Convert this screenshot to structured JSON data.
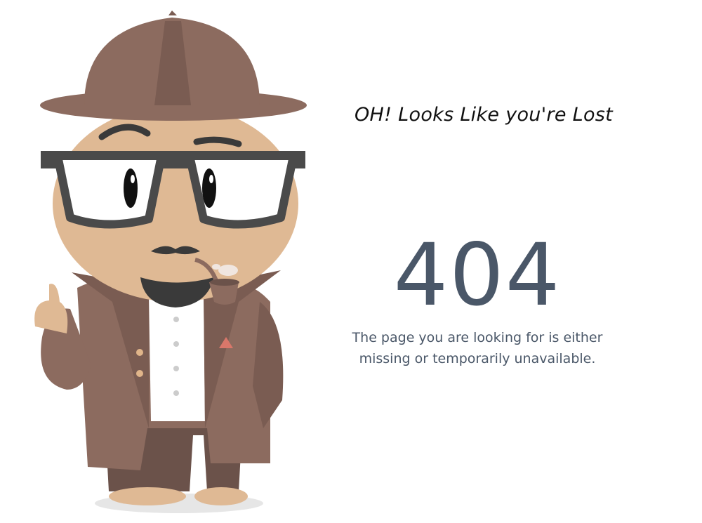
{
  "heading": "OH! Looks Like you're Lost",
  "error_code": "404",
  "message": {
    "line1": "The page you are looking for is either",
    "line2": "missing or temporarily unavailable."
  },
  "illustration": {
    "name": "detective-mascot",
    "colors": {
      "hat": "#8c6b5f",
      "skin": "#dfb994",
      "glasses": "#4a4a4a",
      "coat": "#8c6b5f",
      "shirt": "#ffffff",
      "pants": "#6b524a",
      "shadow": "#e6e6e6"
    }
  },
  "colors": {
    "background": "#ffffff",
    "heading": "#111111",
    "code": "#4a5768",
    "message": "#4a5768"
  }
}
